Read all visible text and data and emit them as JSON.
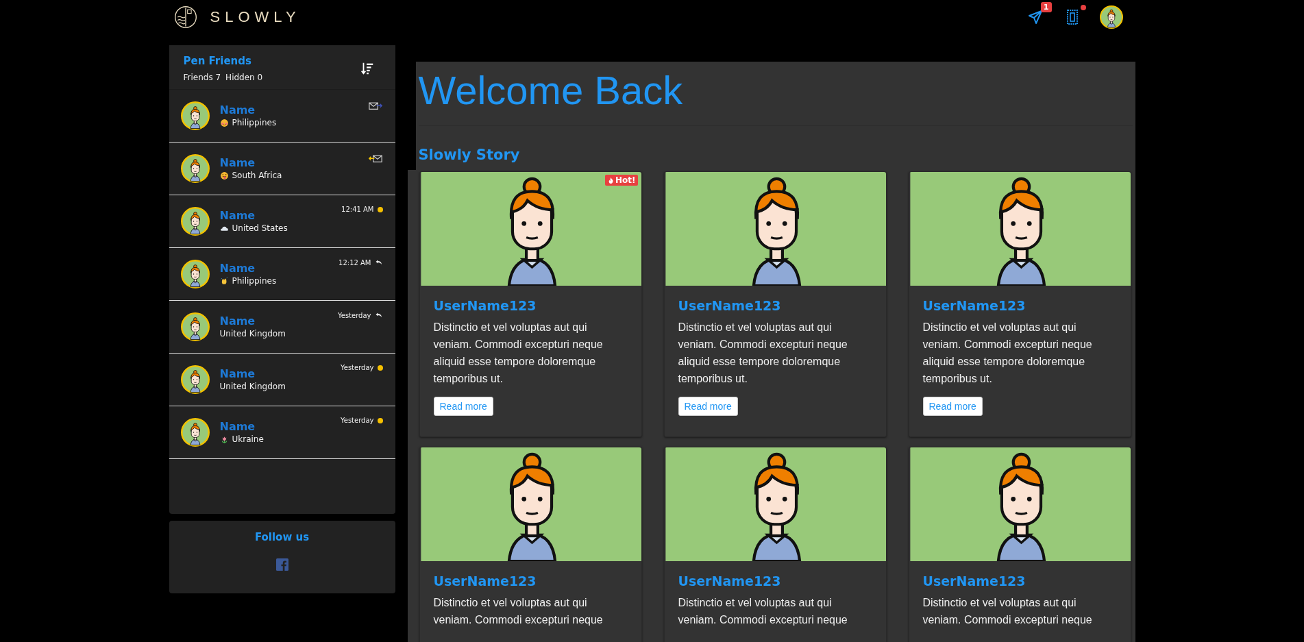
{
  "logo": {
    "text": "SLOWLY"
  },
  "header": {
    "letters_badge": "1",
    "stamp_alert": true
  },
  "sidebar": {
    "title": "Pen Friends",
    "counts": [
      "Friends 7",
      "Hidden 0"
    ],
    "friends": [
      {
        "name": "Name",
        "mood": {
          "kind": "blush"
        },
        "location": "Philippines",
        "status": {
          "kind": "mail-out"
        }
      },
      {
        "name": "Name",
        "mood": {
          "kind": "tongue"
        },
        "location": "South Africa",
        "status": {
          "kind": "mail-in"
        }
      },
      {
        "name": "Name",
        "mood": {
          "kind": "cloud"
        },
        "location": "United States",
        "status": {
          "kind": "unread",
          "time": "12:41 AM"
        }
      },
      {
        "name": "Name",
        "mood": {
          "kind": "clap"
        },
        "location": "Philippines",
        "status": {
          "kind": "replied",
          "time": "12:12 AM"
        }
      },
      {
        "name": "Name",
        "location": "United Kingdom",
        "status": {
          "kind": "replied",
          "time": "Yesterday"
        }
      },
      {
        "name": "Name",
        "location": "United Kingdom",
        "status": {
          "kind": "unread",
          "time": "Yesterday"
        }
      },
      {
        "name": "Name",
        "mood": {
          "kind": "tulip"
        },
        "location": "Ukraine",
        "status": {
          "kind": "unread",
          "time": "Yesterday"
        }
      }
    ]
  },
  "follow": {
    "title": "Follow us"
  },
  "main": {
    "title": "Welcome Back",
    "section": "Slowly Story",
    "stories": [
      {
        "username": "UserName123",
        "badge": "Hot!",
        "text": "Distinctio et vel voluptas aut qui veniam. Commodi excepturi neque aliquid esse tempore doloremque temporibus ut.",
        "button": "Read more"
      },
      {
        "username": "UserName123",
        "text": "Distinctio et vel voluptas aut qui veniam. Commodi excepturi neque aliquid esse tempore doloremque temporibus ut.",
        "button": "Read more"
      },
      {
        "username": "UserName123",
        "text": "Distinctio et vel voluptas aut qui veniam. Commodi excepturi neque aliquid esse tempore doloremque temporibus ut.",
        "button": "Read more"
      },
      {
        "username": "UserName123",
        "text": "Distinctio et vel voluptas aut qui veniam. Commodi excepturi neque"
      },
      {
        "username": "UserName123",
        "text": "Distinctio et vel voluptas aut qui veniam. Commodi excepturi neque"
      },
      {
        "username": "UserName123",
        "text": "Distinctio et vel voluptas aut qui veniam. Commodi excepturi neque"
      }
    ]
  }
}
